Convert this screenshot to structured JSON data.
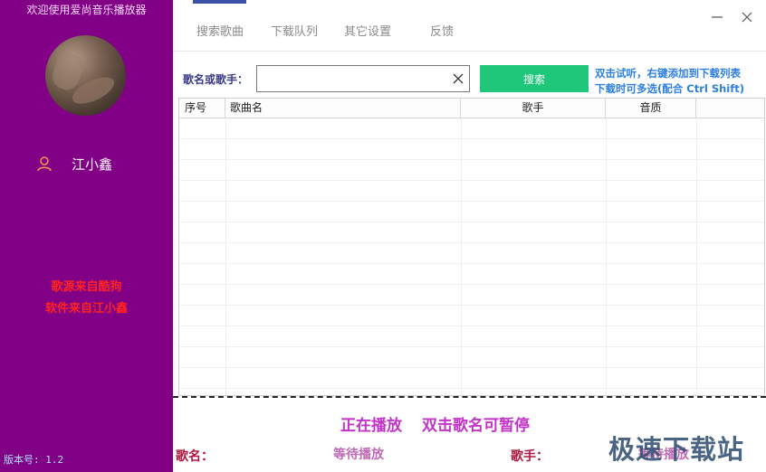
{
  "sidebar": {
    "title": "欢迎使用爱尚音乐播放器",
    "user_name": "江小鑫",
    "credits_line1": "歌源来自酷狗",
    "credits_line2": "软件来自江小鑫",
    "version": "版本号: 1.2",
    "background": "#810086"
  },
  "tabs": [
    {
      "label": "搜索歌曲",
      "active": true
    },
    {
      "label": "下载队列",
      "active": false
    },
    {
      "label": "其它设置",
      "active": false
    },
    {
      "label": "反馈",
      "active": false
    }
  ],
  "search": {
    "label": "歌名或歌手：",
    "value": "",
    "placeholder": "",
    "button_label": "搜索",
    "hint_line1": "双击试听，右键添加到下载列表",
    "hint_line2": "下载时可多选(配合 Ctrl Shift)"
  },
  "table": {
    "columns": [
      "序号",
      "歌曲名",
      "歌手",
      "音质"
    ],
    "rows": []
  },
  "player": {
    "status": "正在播放",
    "hint": "双击歌名可暂停",
    "song_label": "歌名：",
    "song_value": "等待播放",
    "artist_label": "歌手：",
    "artist_value": "等待播放"
  },
  "watermark": "极速下载站",
  "colors": {
    "accent_purple": "#810086",
    "search_button": "#1fc77a",
    "hint_blue": "#2c7fe0",
    "credits_red": "#ff2222",
    "now_playing": "#c233c8"
  }
}
